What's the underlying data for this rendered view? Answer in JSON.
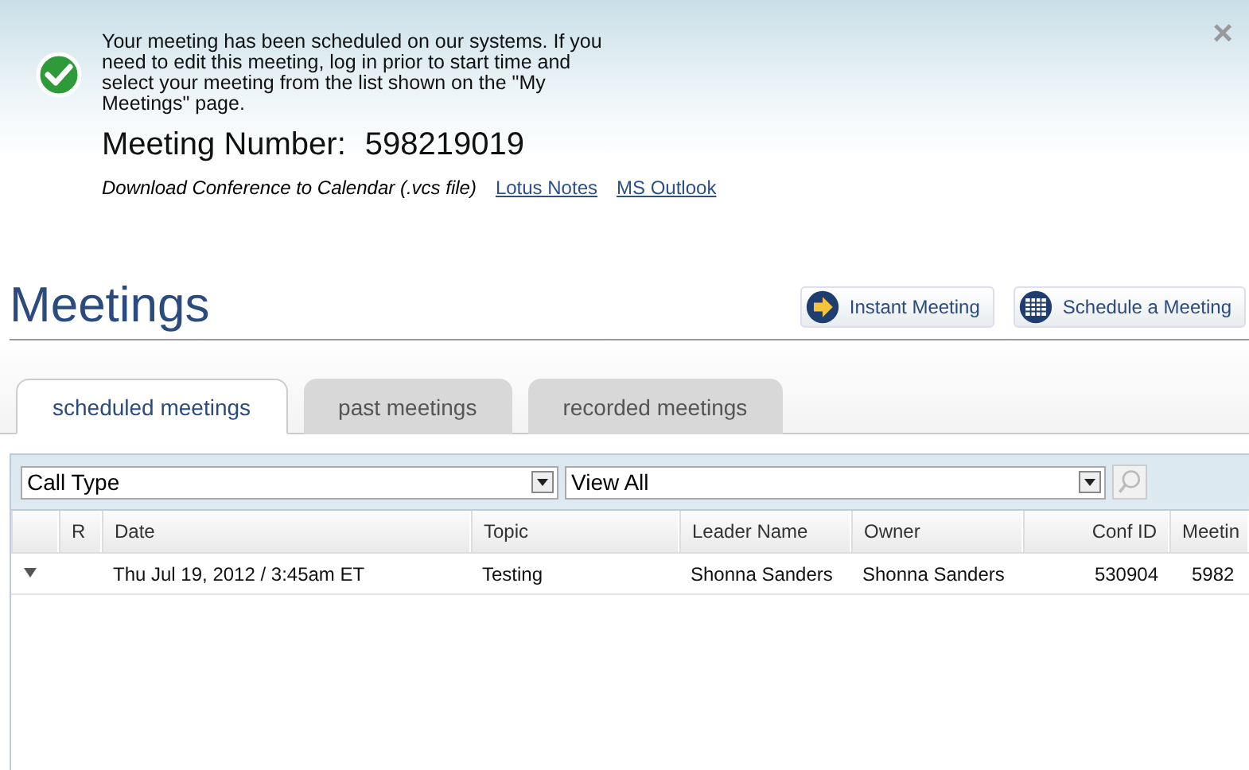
{
  "notice": {
    "message": "Your meeting has been scheduled on our systems. If you need to edit this meeting, log in prior to start time and select your meeting from the list shown on the \"My Meetings\" page.",
    "number_label": "Meeting Number:",
    "number": "598219019",
    "download_label": "Download Conference to Calendar (.vcs file)",
    "links": [
      "Lotus Notes",
      "MS Outlook"
    ],
    "close": "×"
  },
  "title": "Meetings",
  "actions": [
    {
      "kind": "instant",
      "label": "Instant Meeting"
    },
    {
      "kind": "schedule",
      "label": "Schedule a Meeting"
    }
  ],
  "tabs": [
    {
      "label": "scheduled meetings",
      "selected": true
    },
    {
      "label": "past meetings",
      "selected": false
    },
    {
      "label": "recorded meetings",
      "selected": false
    }
  ],
  "filters": [
    {
      "value": "Call Type"
    },
    {
      "value": "View All"
    }
  ],
  "table": {
    "columns": [
      "",
      "R",
      "Date",
      "Topic",
      "Leader Name",
      "Owner",
      "Conf ID",
      "Meetin"
    ],
    "rows": [
      {
        "expanded": false,
        "cells": [
          "",
          "",
          "Thu Jul 19, 2012 / 3:45am ET",
          "Testing",
          "Shonna Sanders",
          "Shonna Sanders",
          "530904",
          "5982"
        ]
      }
    ]
  }
}
